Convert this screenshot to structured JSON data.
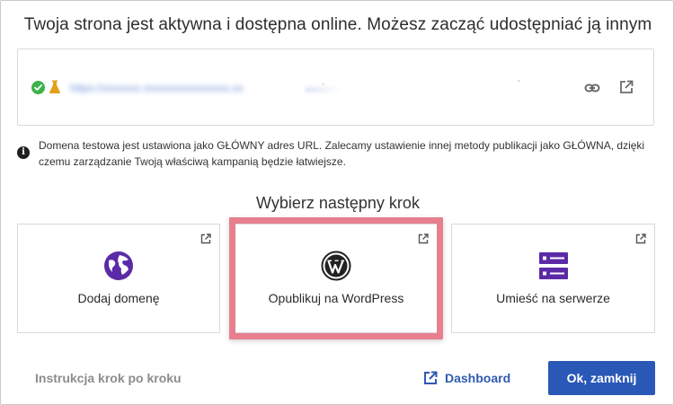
{
  "header": {
    "title": "Twoja strona jest aktywna i dostępna online. Możesz zacząć udostępniać ją innym"
  },
  "url_box": {
    "url_text": "https://xxxxxxx.xxxxxxxxxxxxxxxx.xx",
    "status_icon": "check-circle-icon",
    "test_icon": "flask-icon",
    "copy_icon": "link-icon",
    "open_icon": "external-link-icon"
  },
  "info": {
    "icon": "info-icon",
    "text": "Domena testowa jest ustawiona jako GŁÓWNY adres URL. Zalecamy ustawienie innej metody publikacji jako GŁÓWNA, dzięki czemu zarządzanie Twoją właściwą kampanią będzie łatwiejsze."
  },
  "next_step": {
    "title": "Wybierz następny krok",
    "cards": [
      {
        "label": "Dodaj domenę",
        "icon": "globe-icon"
      },
      {
        "label": "Opublikuj na WordPress",
        "icon": "wordpress-icon"
      },
      {
        "label": "Umieść na serwerze",
        "icon": "server-icon"
      }
    ]
  },
  "footer": {
    "guide_label": "Instrukcja krok po kroku",
    "dashboard_label": "Dashboard",
    "close_label": "Ok, zamknij"
  },
  "colors": {
    "accent": "#2a58b7",
    "icon_purple": "#5b2aa6",
    "success": "#3db34a",
    "highlight": "#e77f8f"
  }
}
